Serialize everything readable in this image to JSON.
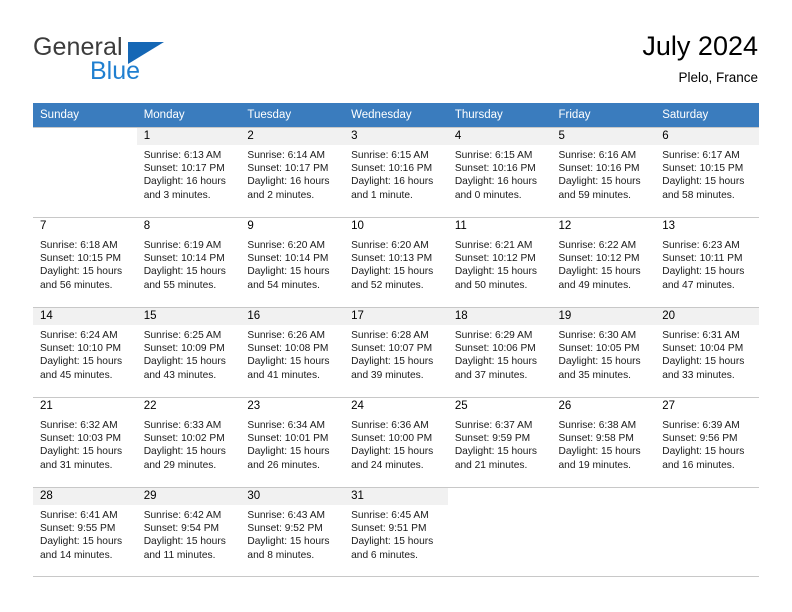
{
  "brand": {
    "name_part1": "General",
    "name_part2": "Blue",
    "triangle_icon": "triangle-icon",
    "accent_color": "#1f7fd0",
    "logo_mark_color": "#1567b5"
  },
  "header": {
    "title": "July 2024",
    "location": "Plelo, France"
  },
  "calendar": {
    "header_bg": "#3a7cbe",
    "header_text_color": "#ffffff",
    "shaded_row_bg": "#f1f1f1",
    "weekdays": [
      "Sunday",
      "Monday",
      "Tuesday",
      "Wednesday",
      "Thursday",
      "Friday",
      "Saturday"
    ],
    "weeks": [
      [
        {
          "day": "",
          "sunrise": "",
          "sunset": "",
          "daylight_line1": "",
          "daylight_line2": ""
        },
        {
          "day": "1",
          "sunrise": "Sunrise: 6:13 AM",
          "sunset": "Sunset: 10:17 PM",
          "daylight_line1": "Daylight: 16 hours",
          "daylight_line2": "and 3 minutes."
        },
        {
          "day": "2",
          "sunrise": "Sunrise: 6:14 AM",
          "sunset": "Sunset: 10:17 PM",
          "daylight_line1": "Daylight: 16 hours",
          "daylight_line2": "and 2 minutes."
        },
        {
          "day": "3",
          "sunrise": "Sunrise: 6:15 AM",
          "sunset": "Sunset: 10:16 PM",
          "daylight_line1": "Daylight: 16 hours",
          "daylight_line2": "and 1 minute."
        },
        {
          "day": "4",
          "sunrise": "Sunrise: 6:15 AM",
          "sunset": "Sunset: 10:16 PM",
          "daylight_line1": "Daylight: 16 hours",
          "daylight_line2": "and 0 minutes."
        },
        {
          "day": "5",
          "sunrise": "Sunrise: 6:16 AM",
          "sunset": "Sunset: 10:16 PM",
          "daylight_line1": "Daylight: 15 hours",
          "daylight_line2": "and 59 minutes."
        },
        {
          "day": "6",
          "sunrise": "Sunrise: 6:17 AM",
          "sunset": "Sunset: 10:15 PM",
          "daylight_line1": "Daylight: 15 hours",
          "daylight_line2": "and 58 minutes."
        }
      ],
      [
        {
          "day": "7",
          "sunrise": "Sunrise: 6:18 AM",
          "sunset": "Sunset: 10:15 PM",
          "daylight_line1": "Daylight: 15 hours",
          "daylight_line2": "and 56 minutes."
        },
        {
          "day": "8",
          "sunrise": "Sunrise: 6:19 AM",
          "sunset": "Sunset: 10:14 PM",
          "daylight_line1": "Daylight: 15 hours",
          "daylight_line2": "and 55 minutes."
        },
        {
          "day": "9",
          "sunrise": "Sunrise: 6:20 AM",
          "sunset": "Sunset: 10:14 PM",
          "daylight_line1": "Daylight: 15 hours",
          "daylight_line2": "and 54 minutes."
        },
        {
          "day": "10",
          "sunrise": "Sunrise: 6:20 AM",
          "sunset": "Sunset: 10:13 PM",
          "daylight_line1": "Daylight: 15 hours",
          "daylight_line2": "and 52 minutes."
        },
        {
          "day": "11",
          "sunrise": "Sunrise: 6:21 AM",
          "sunset": "Sunset: 10:12 PM",
          "daylight_line1": "Daylight: 15 hours",
          "daylight_line2": "and 50 minutes."
        },
        {
          "day": "12",
          "sunrise": "Sunrise: 6:22 AM",
          "sunset": "Sunset: 10:12 PM",
          "daylight_line1": "Daylight: 15 hours",
          "daylight_line2": "and 49 minutes."
        },
        {
          "day": "13",
          "sunrise": "Sunrise: 6:23 AM",
          "sunset": "Sunset: 10:11 PM",
          "daylight_line1": "Daylight: 15 hours",
          "daylight_line2": "and 47 minutes."
        }
      ],
      [
        {
          "day": "14",
          "sunrise": "Sunrise: 6:24 AM",
          "sunset": "Sunset: 10:10 PM",
          "daylight_line1": "Daylight: 15 hours",
          "daylight_line2": "and 45 minutes."
        },
        {
          "day": "15",
          "sunrise": "Sunrise: 6:25 AM",
          "sunset": "Sunset: 10:09 PM",
          "daylight_line1": "Daylight: 15 hours",
          "daylight_line2": "and 43 minutes."
        },
        {
          "day": "16",
          "sunrise": "Sunrise: 6:26 AM",
          "sunset": "Sunset: 10:08 PM",
          "daylight_line1": "Daylight: 15 hours",
          "daylight_line2": "and 41 minutes."
        },
        {
          "day": "17",
          "sunrise": "Sunrise: 6:28 AM",
          "sunset": "Sunset: 10:07 PM",
          "daylight_line1": "Daylight: 15 hours",
          "daylight_line2": "and 39 minutes."
        },
        {
          "day": "18",
          "sunrise": "Sunrise: 6:29 AM",
          "sunset": "Sunset: 10:06 PM",
          "daylight_line1": "Daylight: 15 hours",
          "daylight_line2": "and 37 minutes."
        },
        {
          "day": "19",
          "sunrise": "Sunrise: 6:30 AM",
          "sunset": "Sunset: 10:05 PM",
          "daylight_line1": "Daylight: 15 hours",
          "daylight_line2": "and 35 minutes."
        },
        {
          "day": "20",
          "sunrise": "Sunrise: 6:31 AM",
          "sunset": "Sunset: 10:04 PM",
          "daylight_line1": "Daylight: 15 hours",
          "daylight_line2": "and 33 minutes."
        }
      ],
      [
        {
          "day": "21",
          "sunrise": "Sunrise: 6:32 AM",
          "sunset": "Sunset: 10:03 PM",
          "daylight_line1": "Daylight: 15 hours",
          "daylight_line2": "and 31 minutes."
        },
        {
          "day": "22",
          "sunrise": "Sunrise: 6:33 AM",
          "sunset": "Sunset: 10:02 PM",
          "daylight_line1": "Daylight: 15 hours",
          "daylight_line2": "and 29 minutes."
        },
        {
          "day": "23",
          "sunrise": "Sunrise: 6:34 AM",
          "sunset": "Sunset: 10:01 PM",
          "daylight_line1": "Daylight: 15 hours",
          "daylight_line2": "and 26 minutes."
        },
        {
          "day": "24",
          "sunrise": "Sunrise: 6:36 AM",
          "sunset": "Sunset: 10:00 PM",
          "daylight_line1": "Daylight: 15 hours",
          "daylight_line2": "and 24 minutes."
        },
        {
          "day": "25",
          "sunrise": "Sunrise: 6:37 AM",
          "sunset": "Sunset: 9:59 PM",
          "daylight_line1": "Daylight: 15 hours",
          "daylight_line2": "and 21 minutes."
        },
        {
          "day": "26",
          "sunrise": "Sunrise: 6:38 AM",
          "sunset": "Sunset: 9:58 PM",
          "daylight_line1": "Daylight: 15 hours",
          "daylight_line2": "and 19 minutes."
        },
        {
          "day": "27",
          "sunrise": "Sunrise: 6:39 AM",
          "sunset": "Sunset: 9:56 PM",
          "daylight_line1": "Daylight: 15 hours",
          "daylight_line2": "and 16 minutes."
        }
      ],
      [
        {
          "day": "28",
          "sunrise": "Sunrise: 6:41 AM",
          "sunset": "Sunset: 9:55 PM",
          "daylight_line1": "Daylight: 15 hours",
          "daylight_line2": "and 14 minutes."
        },
        {
          "day": "29",
          "sunrise": "Sunrise: 6:42 AM",
          "sunset": "Sunset: 9:54 PM",
          "daylight_line1": "Daylight: 15 hours",
          "daylight_line2": "and 11 minutes."
        },
        {
          "day": "30",
          "sunrise": "Sunrise: 6:43 AM",
          "sunset": "Sunset: 9:52 PM",
          "daylight_line1": "Daylight: 15 hours",
          "daylight_line2": "and 8 minutes."
        },
        {
          "day": "31",
          "sunrise": "Sunrise: 6:45 AM",
          "sunset": "Sunset: 9:51 PM",
          "daylight_line1": "Daylight: 15 hours",
          "daylight_line2": "and 6 minutes."
        },
        {
          "day": "",
          "sunrise": "",
          "sunset": "",
          "daylight_line1": "",
          "daylight_line2": ""
        },
        {
          "day": "",
          "sunrise": "",
          "sunset": "",
          "daylight_line1": "",
          "daylight_line2": ""
        },
        {
          "day": "",
          "sunrise": "",
          "sunset": "",
          "daylight_line1": "",
          "daylight_line2": ""
        }
      ]
    ]
  }
}
